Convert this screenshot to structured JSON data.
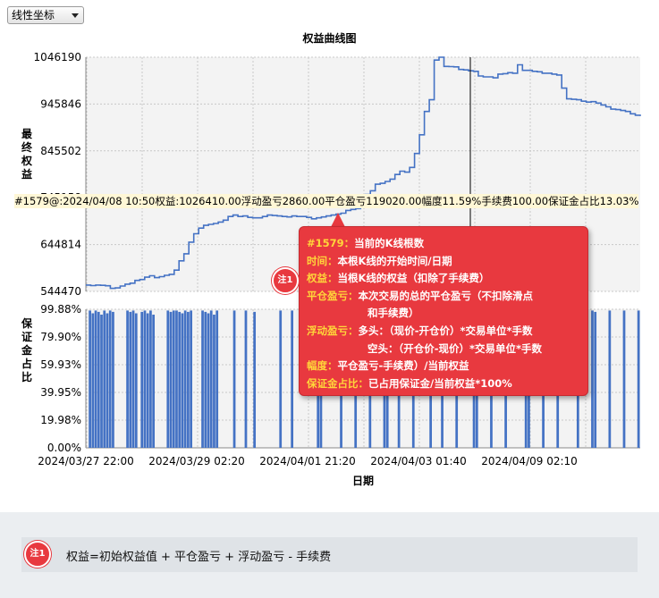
{
  "selector": {
    "value": "线性坐标",
    "icon": "chevron-down-icon"
  },
  "chart_data": [
    {
      "type": "line",
      "title": "权益曲线图",
      "ylabel": "最终权益",
      "yticks": [
        544470,
        644814,
        745158,
        845502,
        945846,
        1046190
      ],
      "ytick_labels": [
        "544470",
        "644814",
        "745158",
        "845502",
        "945846",
        "1046190"
      ],
      "ylim": [
        544470,
        1046190
      ],
      "grid": true,
      "series": [
        {
          "values": [
            558000,
            557000,
            558000,
            557500,
            556500,
            551000,
            552000,
            556000,
            560000,
            562000,
            568000,
            570000,
            575000,
            578000,
            574000,
            576000,
            579000,
            581000,
            590000,
            610000,
            625000,
            650000,
            668000,
            680000,
            686000,
            688000,
            690000,
            693000,
            697000,
            705000,
            708000,
            705000,
            706000,
            703000,
            702000,
            702000,
            705000,
            708000,
            707000,
            706000,
            705000,
            704000,
            706000,
            705000,
            705000,
            703000,
            700000,
            702000,
            704000,
            706000,
            708000,
            710000,
            712000,
            718000,
            720000,
            722000,
            745000,
            752000,
            760000,
            774000,
            776000,
            780000,
            785000,
            795000,
            802000,
            800000,
            810000,
            840000,
            880000,
            930000,
            955000,
            1040000,
            1046190,
            1026410,
            1026000,
            1025500,
            1020000,
            1019000,
            1017000,
            1016000,
            1006000,
            1004000,
            1004000,
            1002000,
            1010000,
            1011000,
            1013000,
            1012000,
            1030000,
            1018000,
            1018000,
            1016000,
            1015000,
            1012000,
            1012000,
            1010000,
            1008000,
            980000,
            957000,
            956000,
            955000,
            952000,
            950000,
            951000,
            948000,
            944000,
            940000,
            935000,
            934000,
            932000,
            930000,
            925000,
            922000,
            920000
          ]
        }
      ]
    },
    {
      "type": "bar",
      "ylabel": "保证金占比",
      "yticks": [
        0,
        19.98,
        39.95,
        59.93,
        79.9,
        99.88
      ],
      "ytick_labels": [
        "0.00%",
        "19.98%",
        "39.95%",
        "59.93%",
        "79.90%",
        "99.88%"
      ],
      "ylim": [
        0,
        99.88
      ],
      "xlabel": "日期",
      "xtick_labels": [
        "2024/03/27 22:00",
        "2024/03/29 02:20",
        "2024/04/01 21:20",
        "2024/04/03 01:40",
        "2024/04/09 02:10"
      ],
      "values": [
        0,
        99,
        97,
        99,
        98,
        96,
        99,
        97,
        99,
        98,
        0,
        0,
        0,
        0,
        99,
        98,
        99,
        97,
        0,
        98,
        99,
        97,
        99,
        96,
        0,
        0,
        0,
        0,
        99,
        98,
        99,
        99,
        98,
        97,
        99,
        98,
        99,
        0,
        0,
        0,
        99,
        98,
        97,
        99,
        96,
        99,
        0,
        0,
        0,
        0,
        0,
        99,
        0,
        0,
        0,
        99,
        0,
        0,
        98,
        0,
        0,
        0,
        0,
        0,
        0,
        0,
        0,
        99,
        0,
        0,
        0,
        99,
        0,
        0,
        0,
        0,
        0,
        0,
        0,
        0,
        99,
        97,
        0,
        0,
        0,
        0,
        0,
        0,
        99,
        0,
        0,
        0,
        0,
        99,
        0,
        0,
        0,
        0,
        98,
        0,
        0,
        0,
        0,
        99,
        99,
        0,
        0,
        0,
        99,
        0,
        0,
        0,
        0,
        99,
        0,
        0,
        0,
        0,
        0,
        99,
        0,
        0,
        0,
        99,
        0,
        0,
        0,
        0,
        99,
        0,
        0,
        0,
        0,
        0,
        99,
        98,
        0,
        0,
        0,
        0,
        99,
        0,
        0,
        0,
        0,
        99,
        0,
        0,
        0,
        0,
        0,
        0,
        99,
        99,
        0,
        0,
        0,
        0,
        99,
        0,
        0,
        0,
        0,
        99,
        0,
        0,
        0,
        0,
        0,
        0,
        99,
        0,
        0,
        0,
        0,
        99,
        98,
        0,
        0,
        0,
        0,
        99,
        0,
        0,
        0,
        0,
        99,
        0,
        0,
        0,
        0,
        99
      ]
    }
  ],
  "info_line": "#1579@:2024/04/08 10:50权益:1026410.00浮动盈亏2860.00平仓盈亏119020.00幅度11.59%手续费100.00保证金占比13.03%",
  "tooltip": {
    "rows": [
      {
        "key": "#1579：",
        "text": "当前的K线根数"
      },
      {
        "key": "时间：",
        "text": "本根K线的开始时间/日期"
      },
      {
        "key": "权益：",
        "text": "当根K线的权益（扣除了手续费）"
      },
      {
        "key": "平仓盈亏：",
        "text": "本次交易的总的平仓盈亏（不扣除滑点"
      },
      {
        "key": "",
        "text": "和手续费）"
      },
      {
        "key": "浮动盈亏：",
        "text": "多头：（现价-开仓价）*交易单位*手数"
      },
      {
        "key": "",
        "text": "空头：（开仓价-现价）*交易单位*手数"
      },
      {
        "key": "幅度：",
        "text": "平仓盈亏-手续费）/当前权益"
      },
      {
        "key": "保证金占比：",
        "text": "已占用保证金/当前权益*100%"
      }
    ]
  },
  "note_badge": "注1",
  "formula": {
    "badge": "注1",
    "text": "权益=初始权益值 + 平仓盈亏 + 浮动盈亏 - 手续费"
  },
  "colors": {
    "series": "#4472c4",
    "tooltip": "#e8393f",
    "tooltip_key": "#ffd63a",
    "cursor": "#000000"
  }
}
